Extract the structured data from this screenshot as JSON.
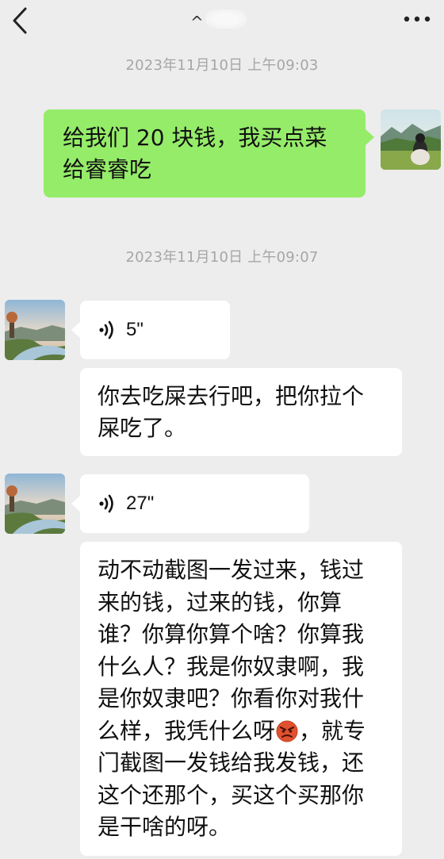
{
  "header": {
    "back_icon": "chevron-left-icon",
    "more_icon": "more-dots-icon"
  },
  "chat": {
    "timestamp_1": "2023年11月10日 上午09:03",
    "timestamp_2": "2023年11月10日 上午09:07",
    "msg_1_part1": "给我们 20 块钱，我买点菜",
    "msg_1_part2": "给睿睿吃",
    "voice_1_duration": "5\"",
    "msg_2_line1": "你去吃屎去行吧，把你拉个",
    "msg_2_line2": "屎吃了。",
    "voice_2_duration": "27\"",
    "msg_3_line1": "动不动截图一发过来，钱过",
    "msg_3_line2": "来的钱，过来的钱，你算",
    "msg_3_line3": "谁？你算你算个啥？你算我",
    "msg_3_line4": "什么人？我是你奴隶啊，我",
    "msg_3_line5": "是你奴隶吧？你看你对我什",
    "msg_3_line6a": "么样，我凭什么呀",
    "msg_3_line6b": "，就专",
    "msg_3_line7": "门截图一发钱给我发钱，还",
    "msg_3_line8": "这个还那个，买这个买那你",
    "msg_3_line9": "是干啥的呀。"
  },
  "icons": {
    "voice": "voice-wave-icon",
    "angry_emoji": "angry-face-emoji",
    "self_avatar": "self-avatar",
    "contact_avatar": "contact-avatar"
  },
  "colors": {
    "background": "#ededed",
    "sent_bubble": "#95ec69",
    "received_bubble": "#ffffff",
    "timestamp": "#a6a6a6"
  }
}
